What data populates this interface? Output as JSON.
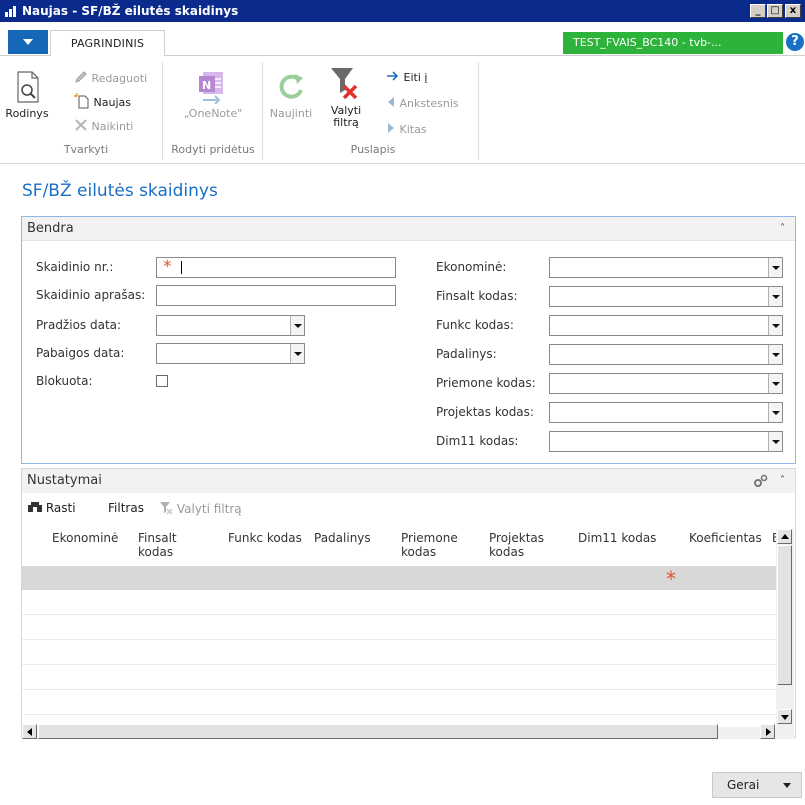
{
  "window": {
    "title": "Naujas - SF/BŽ eilutės skaidinys",
    "minimize": "_",
    "maximize": "□",
    "close": "x"
  },
  "ribbon": {
    "tab_home": "PAGRINDINIS",
    "environment": "TEST_FVAIS_BC140 - tvb-...",
    "help": "?",
    "manage": {
      "view": "Rodinys",
      "edit": "Redaguoti",
      "new": "Naujas",
      "delete": "Naikinti",
      "group": "Tvarkyti"
    },
    "show_attached": {
      "onenote": "„OneNote\"",
      "group": "Rodyti pridėtus"
    },
    "page": {
      "refresh": "Naujinti",
      "clear_filter": "Valyti filtrą",
      "goto": "Eiti į",
      "previous": "Ankstesnis",
      "next": "Kitas",
      "group": "Puslapis"
    }
  },
  "page_title": "SF/BŽ eilutės skaidinys",
  "general": {
    "header": "Bendra",
    "left_fields": [
      {
        "label": "Skaidinio nr.:",
        "value": ""
      },
      {
        "label": "Skaidinio aprašas:",
        "value": ""
      },
      {
        "label": "Pradžios data:",
        "value": ""
      },
      {
        "label": "Pabaigos data:",
        "value": ""
      },
      {
        "label": "Blokuota:",
        "value": ""
      }
    ],
    "right_fields": [
      {
        "label": "Ekonominė:",
        "value": ""
      },
      {
        "label": "Finsalt kodas:",
        "value": ""
      },
      {
        "label": "Funkc kodas:",
        "value": ""
      },
      {
        "label": "Padalinys:",
        "value": ""
      },
      {
        "label": "Priemone kodas:",
        "value": ""
      },
      {
        "label": "Projektas kodas:",
        "value": ""
      },
      {
        "label": "Dim11 kodas:",
        "value": ""
      }
    ]
  },
  "settings": {
    "header": "Nustatymai",
    "toolbar": {
      "find": "Rasti",
      "filter": "Filtras",
      "clear_filter": "Valyti filtrą"
    },
    "columns": [
      {
        "label": "Ekonominė"
      },
      {
        "label": "Finsalt\nkodas"
      },
      {
        "label": "Funkc kodas"
      },
      {
        "label": "Padalinys"
      },
      {
        "label": "Priemone\nkodas"
      },
      {
        "label": "Projektas\nkodas"
      },
      {
        "label": "Dim11 kodas"
      },
      {
        "label": "Koeficientas"
      },
      {
        "label": "B"
      }
    ]
  },
  "footer": {
    "ok": "Gerai"
  },
  "colors": {
    "titlebar": "#0a2a8c",
    "accent": "#1a6fc6",
    "environment": "#2cb33a",
    "required": "#e0522b"
  }
}
